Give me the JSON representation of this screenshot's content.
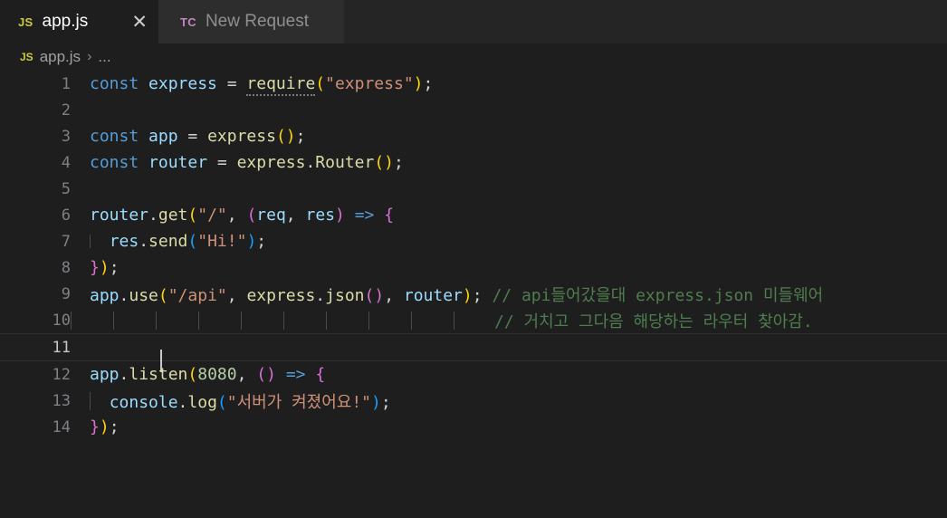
{
  "window": {
    "app": "Visual Studio Code",
    "background": "#1e1e1e"
  },
  "tabs": [
    {
      "icon": "JS",
      "icon_name": "javascript-file-icon",
      "label": "app.js",
      "active": true,
      "close_glyph": "✕",
      "icon_color": "#cbcb41"
    },
    {
      "icon": "TC",
      "icon_name": "thunder-client-icon",
      "label": "New Request",
      "active": false,
      "icon_color": "#c586c0"
    }
  ],
  "breadcrumb": {
    "icon": "JS",
    "file": "app.js",
    "separator": "›",
    "dots": "..."
  },
  "editor": {
    "language": "javascript",
    "active_line": 11,
    "cursor_line": 11,
    "cursor_column": 1,
    "line_numbers": [
      "1",
      "2",
      "3",
      "4",
      "5",
      "6",
      "7",
      "8",
      "9",
      "10",
      "11",
      "12",
      "13",
      "14"
    ],
    "lines": {
      "l1": {
        "n": "1",
        "kw": "const",
        "name": "express",
        "eq": "=",
        "require": "require",
        "paren_open": "(",
        "string": "\"express\"",
        "paren_close": ")",
        "semi": ";"
      },
      "l3": {
        "n": "3",
        "kw": "const",
        "name": "app",
        "eq": "=",
        "call": "express",
        "parens": "()",
        "semi": ";"
      },
      "l4": {
        "n": "4",
        "kw": "const",
        "name": "router",
        "eq": "=",
        "obj": "express",
        "dot": ".",
        "method": "Router",
        "parens": "()",
        "semi": ";"
      },
      "l6": {
        "n": "6",
        "obj": "router",
        "dot": ".",
        "method": "get",
        "paren_open": "(",
        "string": "\"/\"",
        "comma": ",",
        "params_open": "(",
        "p1": "req",
        "p_comma": ",",
        "p2": "res",
        "params_close": ")",
        "arrow": "=>",
        "brace": "{"
      },
      "l7": {
        "n": "7",
        "obj": "res",
        "dot": ".",
        "method": "send",
        "paren_open": "(",
        "string": "\"Hi!\"",
        "paren_close": ")",
        "semi": ";"
      },
      "l8": {
        "n": "8",
        "brace": "}",
        "paren": ")",
        "semi": ";"
      },
      "l9": {
        "n": "9",
        "obj": "app",
        "dot": ".",
        "method": "use",
        "paren_open": "(",
        "string": "\"/api\"",
        "comma1": ",",
        "obj2": "express",
        "dot2": ".",
        "method2": "json",
        "parens2": "()",
        "comma2": ",",
        "arg3": "router",
        "paren_close": ")",
        "semi": ";",
        "comment": "// api들어갔을대 express.json 미들웨어"
      },
      "l10": {
        "n": "10",
        "comment": "// 거치고 그다음 해당하는 라우터 찾아감."
      },
      "l11": {
        "n": "11",
        "text": ""
      },
      "l12": {
        "n": "12",
        "obj": "app",
        "dot": ".",
        "method": "listen",
        "paren_open": "(",
        "number": "8080",
        "comma": ",",
        "params": "()",
        "arrow": "=>",
        "brace": "{"
      },
      "l13": {
        "n": "13",
        "obj": "console",
        "dot": ".",
        "method": "log",
        "paren_open": "(",
        "string": "\"서버가 켜졌어요!\"",
        "paren_close": ")",
        "semi": ";"
      },
      "l14": {
        "n": "14",
        "brace": "}",
        "paren": ")",
        "semi": ";"
      }
    },
    "empty_lines": [
      "2",
      "5"
    ]
  },
  "colors": {
    "keyword": "#569cd6",
    "variable": "#9cdcfe",
    "function": "#dcdcaa",
    "string": "#ce9178",
    "number": "#b5cea8",
    "comment": "#4f7d4f",
    "bracket1": "#ffd700",
    "bracket2": "#da70d6",
    "bracket3": "#179fff",
    "editor_bg": "#1e1e1e",
    "tabbar_bg": "#252526"
  }
}
